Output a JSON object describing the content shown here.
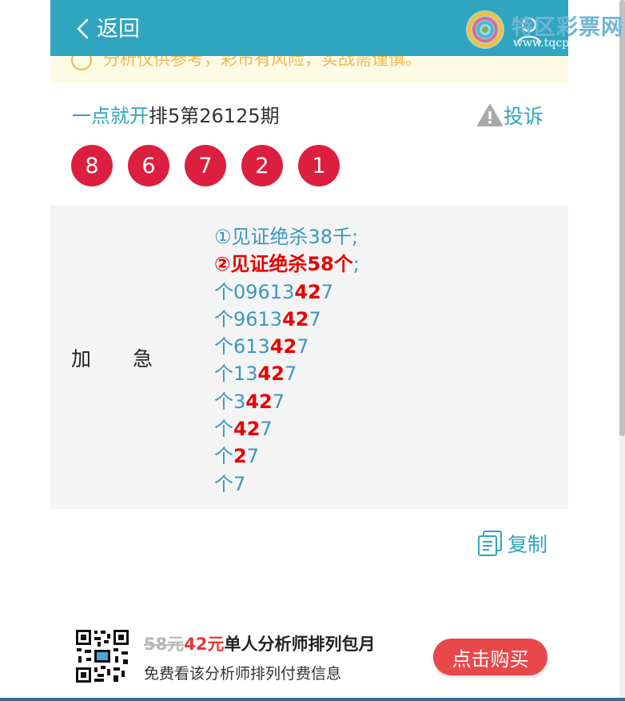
{
  "header": {
    "back_label": "返回",
    "logo_title": "特区彩票网",
    "logo_url": "www.tqcp.net"
  },
  "notice": {
    "text": "分析仅供参考，彩市有风险，实战需谨慎。"
  },
  "detail": {
    "analyst_name": "一点就开",
    "issue_title": "排5第26125期",
    "complain_label": "投诉",
    "balls": [
      "8",
      "6",
      "7",
      "2",
      "1"
    ]
  },
  "panel": {
    "label_left": "加",
    "label_right": "急",
    "line1": "①见证绝杀38千;",
    "line2_main": "②见证绝杀58个",
    "line2_semi": ";",
    "rows": [
      {
        "pre": "个09613",
        "hl": "42",
        "post": "7"
      },
      {
        "pre": "个9613",
        "hl": "42",
        "post": "7"
      },
      {
        "pre": "个613",
        "hl": "42",
        "post": "7"
      },
      {
        "pre": "个13",
        "hl": "42",
        "post": "7"
      },
      {
        "pre": "个3",
        "hl": "42",
        "post": "7"
      },
      {
        "pre": "个",
        "hl": "42",
        "post": "7"
      },
      {
        "pre": "个",
        "hl": "2",
        "post": "7"
      },
      {
        "pre": "个7",
        "hl": "",
        "post": ""
      }
    ]
  },
  "copy_label": "复制",
  "promo": {
    "old_price": "58元",
    "new_price": "42元",
    "name": "单人分析师排列包月",
    "sub": "免费看该分析师排列付费信息",
    "buy_label": "点击购买"
  },
  "colors": {
    "header": "#30a5bf",
    "ball": "#dc1f3f",
    "highlight": "#e80000",
    "buy": "#e9484a"
  }
}
